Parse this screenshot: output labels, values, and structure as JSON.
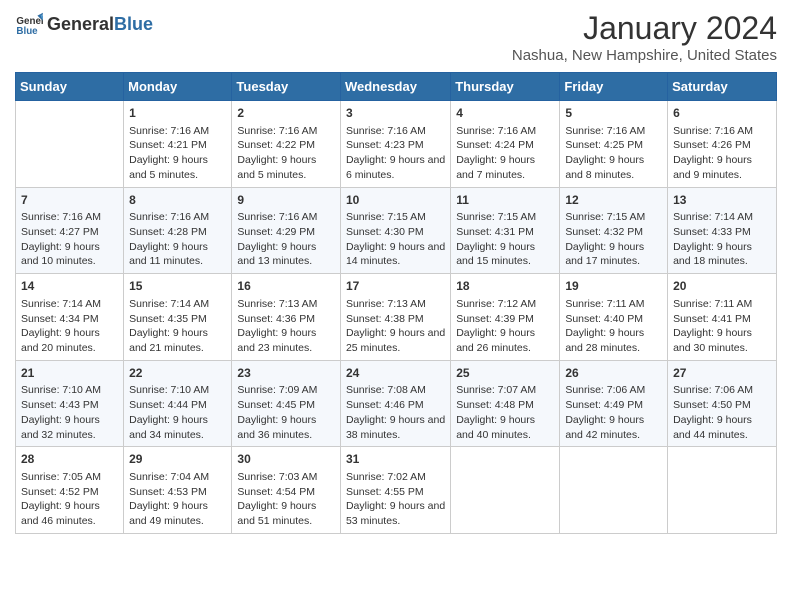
{
  "logo": {
    "general": "General",
    "blue": "Blue"
  },
  "title": "January 2024",
  "location": "Nashua, New Hampshire, United States",
  "weekdays": [
    "Sunday",
    "Monday",
    "Tuesday",
    "Wednesday",
    "Thursday",
    "Friday",
    "Saturday"
  ],
  "weeks": [
    [
      {
        "day": "",
        "sunrise": "",
        "sunset": "",
        "daylight": ""
      },
      {
        "day": "1",
        "sunrise": "Sunrise: 7:16 AM",
        "sunset": "Sunset: 4:21 PM",
        "daylight": "Daylight: 9 hours and 5 minutes."
      },
      {
        "day": "2",
        "sunrise": "Sunrise: 7:16 AM",
        "sunset": "Sunset: 4:22 PM",
        "daylight": "Daylight: 9 hours and 5 minutes."
      },
      {
        "day": "3",
        "sunrise": "Sunrise: 7:16 AM",
        "sunset": "Sunset: 4:23 PM",
        "daylight": "Daylight: 9 hours and 6 minutes."
      },
      {
        "day": "4",
        "sunrise": "Sunrise: 7:16 AM",
        "sunset": "Sunset: 4:24 PM",
        "daylight": "Daylight: 9 hours and 7 minutes."
      },
      {
        "day": "5",
        "sunrise": "Sunrise: 7:16 AM",
        "sunset": "Sunset: 4:25 PM",
        "daylight": "Daylight: 9 hours and 8 minutes."
      },
      {
        "day": "6",
        "sunrise": "Sunrise: 7:16 AM",
        "sunset": "Sunset: 4:26 PM",
        "daylight": "Daylight: 9 hours and 9 minutes."
      }
    ],
    [
      {
        "day": "7",
        "sunrise": "Sunrise: 7:16 AM",
        "sunset": "Sunset: 4:27 PM",
        "daylight": "Daylight: 9 hours and 10 minutes."
      },
      {
        "day": "8",
        "sunrise": "Sunrise: 7:16 AM",
        "sunset": "Sunset: 4:28 PM",
        "daylight": "Daylight: 9 hours and 11 minutes."
      },
      {
        "day": "9",
        "sunrise": "Sunrise: 7:16 AM",
        "sunset": "Sunset: 4:29 PM",
        "daylight": "Daylight: 9 hours and 13 minutes."
      },
      {
        "day": "10",
        "sunrise": "Sunrise: 7:15 AM",
        "sunset": "Sunset: 4:30 PM",
        "daylight": "Daylight: 9 hours and 14 minutes."
      },
      {
        "day": "11",
        "sunrise": "Sunrise: 7:15 AM",
        "sunset": "Sunset: 4:31 PM",
        "daylight": "Daylight: 9 hours and 15 minutes."
      },
      {
        "day": "12",
        "sunrise": "Sunrise: 7:15 AM",
        "sunset": "Sunset: 4:32 PM",
        "daylight": "Daylight: 9 hours and 17 minutes."
      },
      {
        "day": "13",
        "sunrise": "Sunrise: 7:14 AM",
        "sunset": "Sunset: 4:33 PM",
        "daylight": "Daylight: 9 hours and 18 minutes."
      }
    ],
    [
      {
        "day": "14",
        "sunrise": "Sunrise: 7:14 AM",
        "sunset": "Sunset: 4:34 PM",
        "daylight": "Daylight: 9 hours and 20 minutes."
      },
      {
        "day": "15",
        "sunrise": "Sunrise: 7:14 AM",
        "sunset": "Sunset: 4:35 PM",
        "daylight": "Daylight: 9 hours and 21 minutes."
      },
      {
        "day": "16",
        "sunrise": "Sunrise: 7:13 AM",
        "sunset": "Sunset: 4:36 PM",
        "daylight": "Daylight: 9 hours and 23 minutes."
      },
      {
        "day": "17",
        "sunrise": "Sunrise: 7:13 AM",
        "sunset": "Sunset: 4:38 PM",
        "daylight": "Daylight: 9 hours and 25 minutes."
      },
      {
        "day": "18",
        "sunrise": "Sunrise: 7:12 AM",
        "sunset": "Sunset: 4:39 PM",
        "daylight": "Daylight: 9 hours and 26 minutes."
      },
      {
        "day": "19",
        "sunrise": "Sunrise: 7:11 AM",
        "sunset": "Sunset: 4:40 PM",
        "daylight": "Daylight: 9 hours and 28 minutes."
      },
      {
        "day": "20",
        "sunrise": "Sunrise: 7:11 AM",
        "sunset": "Sunset: 4:41 PM",
        "daylight": "Daylight: 9 hours and 30 minutes."
      }
    ],
    [
      {
        "day": "21",
        "sunrise": "Sunrise: 7:10 AM",
        "sunset": "Sunset: 4:43 PM",
        "daylight": "Daylight: 9 hours and 32 minutes."
      },
      {
        "day": "22",
        "sunrise": "Sunrise: 7:10 AM",
        "sunset": "Sunset: 4:44 PM",
        "daylight": "Daylight: 9 hours and 34 minutes."
      },
      {
        "day": "23",
        "sunrise": "Sunrise: 7:09 AM",
        "sunset": "Sunset: 4:45 PM",
        "daylight": "Daylight: 9 hours and 36 minutes."
      },
      {
        "day": "24",
        "sunrise": "Sunrise: 7:08 AM",
        "sunset": "Sunset: 4:46 PM",
        "daylight": "Daylight: 9 hours and 38 minutes."
      },
      {
        "day": "25",
        "sunrise": "Sunrise: 7:07 AM",
        "sunset": "Sunset: 4:48 PM",
        "daylight": "Daylight: 9 hours and 40 minutes."
      },
      {
        "day": "26",
        "sunrise": "Sunrise: 7:06 AM",
        "sunset": "Sunset: 4:49 PM",
        "daylight": "Daylight: 9 hours and 42 minutes."
      },
      {
        "day": "27",
        "sunrise": "Sunrise: 7:06 AM",
        "sunset": "Sunset: 4:50 PM",
        "daylight": "Daylight: 9 hours and 44 minutes."
      }
    ],
    [
      {
        "day": "28",
        "sunrise": "Sunrise: 7:05 AM",
        "sunset": "Sunset: 4:52 PM",
        "daylight": "Daylight: 9 hours and 46 minutes."
      },
      {
        "day": "29",
        "sunrise": "Sunrise: 7:04 AM",
        "sunset": "Sunset: 4:53 PM",
        "daylight": "Daylight: 9 hours and 49 minutes."
      },
      {
        "day": "30",
        "sunrise": "Sunrise: 7:03 AM",
        "sunset": "Sunset: 4:54 PM",
        "daylight": "Daylight: 9 hours and 51 minutes."
      },
      {
        "day": "31",
        "sunrise": "Sunrise: 7:02 AM",
        "sunset": "Sunset: 4:55 PM",
        "daylight": "Daylight: 9 hours and 53 minutes."
      },
      {
        "day": "",
        "sunrise": "",
        "sunset": "",
        "daylight": ""
      },
      {
        "day": "",
        "sunrise": "",
        "sunset": "",
        "daylight": ""
      },
      {
        "day": "",
        "sunrise": "",
        "sunset": "",
        "daylight": ""
      }
    ]
  ]
}
